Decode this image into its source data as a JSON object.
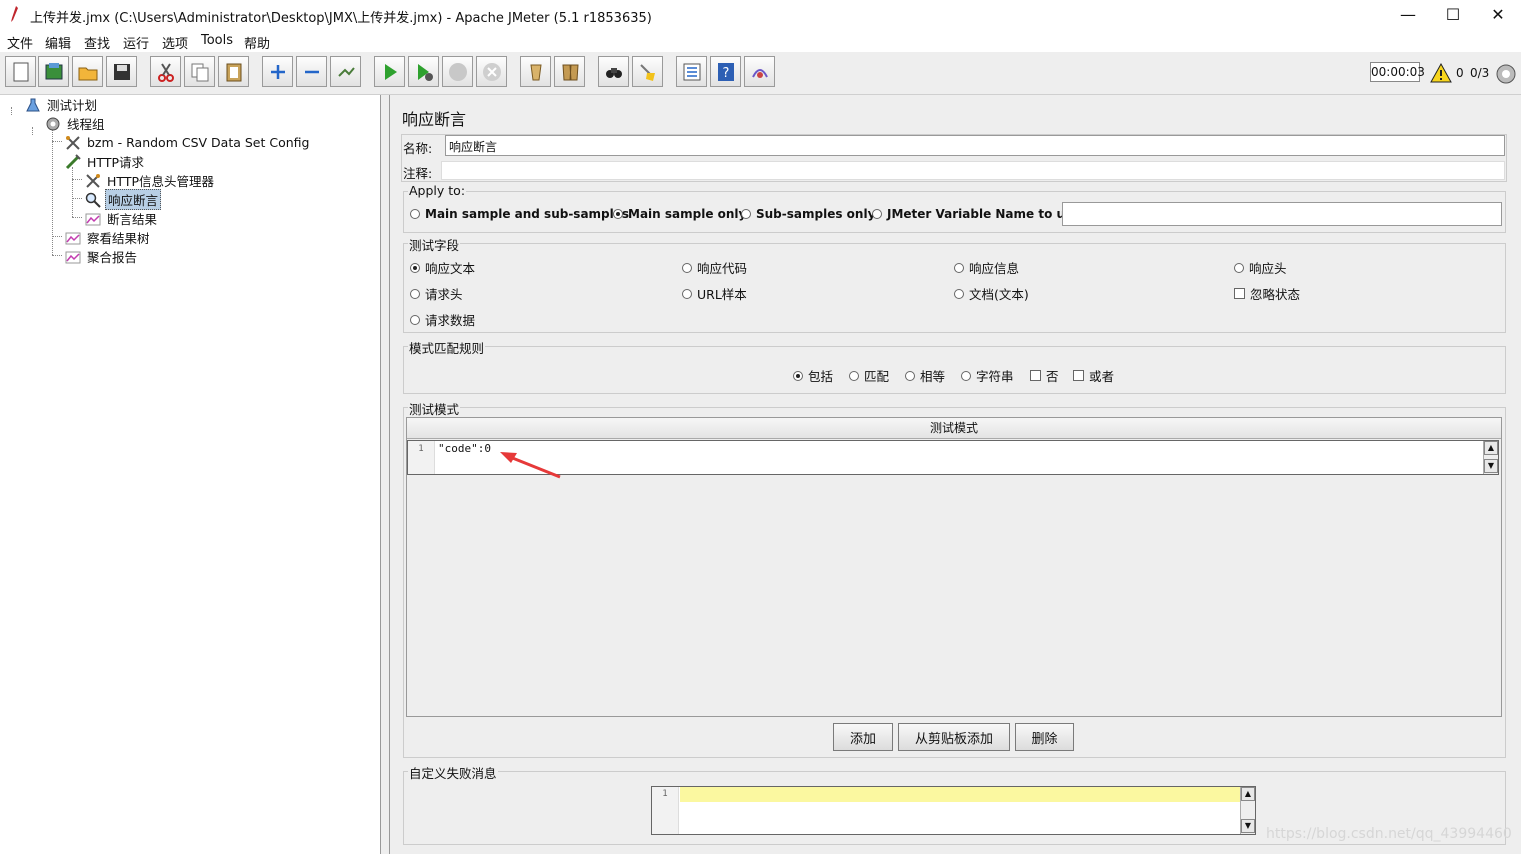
{
  "window": {
    "title": "上传并发.jmx (C:\\Users\\Administrator\\Desktop\\JMX\\上传并发.jmx) - Apache JMeter (5.1 r1853635)",
    "minimize": "—",
    "maximize": "☐",
    "close": "✕"
  },
  "menu": [
    "文件",
    "编辑",
    "查找",
    "运行",
    "选项",
    "Tools",
    "帮助"
  ],
  "toolbar": {
    "timer": "00:00:03",
    "warning_count": "0",
    "threads": "0/3",
    "icons": [
      "new-icon",
      "templates-icon",
      "open-icon",
      "save-icon",
      "cut-icon",
      "copy-icon",
      "paste-icon",
      "expand-icon",
      "collapse-icon",
      "toggle-icon",
      "start-icon",
      "start-no-pause-icon",
      "stop-icon",
      "shutdown-icon",
      "clear-icon",
      "clear-all-icon",
      "search-icon",
      "reset-search-icon",
      "function-helper-icon",
      "help-icon",
      "remote-icon"
    ]
  },
  "tree": {
    "nodes": [
      {
        "label": "测试计划",
        "icon": "test-plan-icon"
      },
      {
        "label": "线程组",
        "icon": "thread-group-icon"
      },
      {
        "label": "bzm - Random CSV Data Set Config",
        "icon": "config-tool-icon"
      },
      {
        "label": "HTTP请求",
        "icon": "sampler-icon"
      },
      {
        "label": "HTTP信息头管理器",
        "icon": "header-manager-icon"
      },
      {
        "label": "响应断言",
        "icon": "assertion-icon"
      },
      {
        "label": "断言结果",
        "icon": "listener-icon"
      },
      {
        "label": "察看结果树",
        "icon": "listener-icon"
      },
      {
        "label": "聚合报告",
        "icon": "listener-icon"
      }
    ]
  },
  "panel": {
    "title": "响应断言",
    "name_label": "名称:",
    "name_value": "响应断言",
    "comment_label": "注释:",
    "comment_value": "",
    "apply_to": {
      "title": "Apply to:",
      "options": [
        "Main sample and sub-samples",
        "Main sample only",
        "Sub-samples only",
        "JMeter Variable Name to use"
      ],
      "selected": "Main sample only",
      "variable_value": ""
    },
    "fields": {
      "title": "测试字段",
      "options": [
        "响应文本",
        "响应代码",
        "响应信息",
        "响应头",
        "请求头",
        "URL样本",
        "文档(文本)",
        "忽略状态",
        "请求数据"
      ],
      "selected": "响应文本",
      "ignore_status_checked": false
    },
    "rules": {
      "title": "模式匹配规则",
      "options": [
        "包括",
        "匹配",
        "相等",
        "字符串",
        "否",
        "或者"
      ],
      "selected": "包括"
    },
    "patterns": {
      "title": "测试模式",
      "column_header": "测试模式",
      "line_number": "1",
      "value": "\"code\":0",
      "buttons": [
        "添加",
        "从剪贴板添加",
        "删除"
      ]
    },
    "failure": {
      "title": "自定义失败消息",
      "line_number": "1",
      "value": ""
    }
  },
  "watermark": "https://blog.csdn.net/qq_43994460",
  "colors": {
    "selection": "#b8cfe5",
    "highlight_line": "#fbf8a0",
    "arrow": "#e63939"
  }
}
